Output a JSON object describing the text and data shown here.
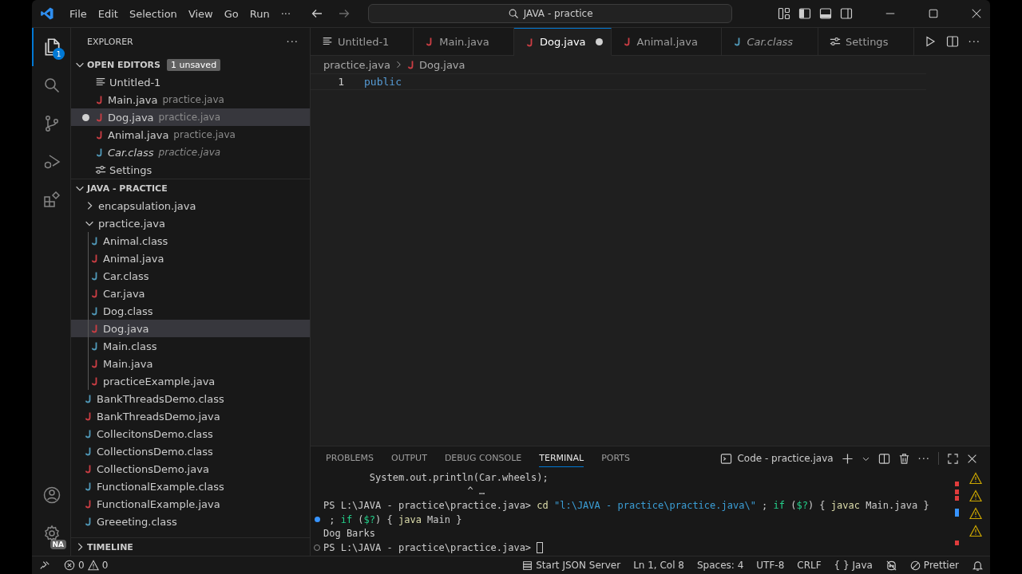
{
  "title_bar": {
    "menus": [
      "File",
      "Edit",
      "Selection",
      "View",
      "Go",
      "Run"
    ],
    "more": "···",
    "search": "JAVA - practice"
  },
  "activity_bar": {
    "items": [
      {
        "kind": "explorer",
        "selected": true,
        "badge": "1"
      },
      {
        "kind": "search",
        "selected": false
      },
      {
        "kind": "source-control",
        "selected": false
      },
      {
        "kind": "run-debug",
        "selected": false
      },
      {
        "kind": "extensions",
        "selected": false
      }
    ],
    "bottom": [
      {
        "kind": "account"
      },
      {
        "kind": "manage",
        "badge": "NA"
      }
    ]
  },
  "sidebar": {
    "title": "EXPLORER",
    "more": "···",
    "open_editors": {
      "title": "OPEN EDITORS",
      "expanded": true,
      "badge": "1 unsaved",
      "items": [
        {
          "label": "Untitled-1",
          "kind": "untitled",
          "dirty": false,
          "italic": false,
          "selected": false
        },
        {
          "label": "Main.java",
          "description": "practice.java",
          "kind": "java",
          "dirty": false,
          "italic": false,
          "selected": false
        },
        {
          "label": "Dog.java",
          "description": "practice.java",
          "kind": "java",
          "dirty": true,
          "italic": false,
          "selected": true
        },
        {
          "label": "Animal.java",
          "description": "practice.java",
          "kind": "java",
          "dirty": false,
          "italic": false,
          "selected": false
        },
        {
          "label": "Car.class",
          "description": "practice.java",
          "kind": "class",
          "dirty": false,
          "italic": true,
          "selected": false
        },
        {
          "label": "Settings",
          "kind": "settings",
          "dirty": false,
          "italic": false,
          "selected": false
        }
      ]
    },
    "workspace": {
      "title": "JAVA - PRACTICE",
      "expanded": true,
      "items": [
        {
          "label": "encapsulation.java",
          "kind": "folder",
          "expanded": false,
          "selected": false
        },
        {
          "label": "practice.java",
          "kind": "folder",
          "expanded": true,
          "selected": false,
          "children": [
            {
              "label": "Animal.class",
              "kind": "class",
              "selected": false
            },
            {
              "label": "Animal.java",
              "kind": "java",
              "selected": false
            },
            {
              "label": "Car.class",
              "kind": "class",
              "selected": false
            },
            {
              "label": "Car.java",
              "kind": "java",
              "selected": false
            },
            {
              "label": "Dog.class",
              "kind": "class",
              "selected": false
            },
            {
              "label": "Dog.java",
              "kind": "java",
              "selected": true
            },
            {
              "label": "Main.class",
              "kind": "class",
              "selected": false
            },
            {
              "label": "Main.java",
              "kind": "java",
              "selected": false
            },
            {
              "label": "practiceExample.java",
              "kind": "java",
              "selected": false
            }
          ]
        },
        {
          "label": "BankThreadsDemo.class",
          "kind": "class",
          "selected": false
        },
        {
          "label": "BankThreadsDemo.java",
          "kind": "java",
          "selected": false
        },
        {
          "label": "CollecitonsDemo.class",
          "kind": "class",
          "selected": false
        },
        {
          "label": "CollectionsDemo.class",
          "kind": "class",
          "selected": false
        },
        {
          "label": "CollectionsDemo.java",
          "kind": "java",
          "selected": false
        },
        {
          "label": "FunctionalExample.class",
          "kind": "class",
          "selected": false
        },
        {
          "label": "FunctionalExample.java",
          "kind": "java",
          "selected": false
        },
        {
          "label": "Greeeting.class",
          "kind": "class",
          "selected": false
        }
      ]
    },
    "timeline": {
      "title": "TIMELINE",
      "expanded": false
    }
  },
  "editor": {
    "tabs": [
      {
        "label": "Untitled-1",
        "kind": "untitled",
        "selected": false,
        "dirty": false,
        "italic": false
      },
      {
        "label": "Main.java",
        "kind": "java",
        "selected": false,
        "dirty": false,
        "italic": false
      },
      {
        "label": "Dog.java",
        "kind": "java",
        "selected": true,
        "dirty": true,
        "italic": false
      },
      {
        "label": "Animal.java",
        "kind": "java",
        "selected": false,
        "dirty": false,
        "italic": false
      },
      {
        "label": "Car.class",
        "kind": "class",
        "selected": false,
        "dirty": false,
        "italic": true
      },
      {
        "label": "Settings",
        "kind": "settings",
        "selected": false,
        "dirty": false,
        "italic": false
      }
    ],
    "more": "···",
    "breadcrumbs": [
      {
        "label": "practice.java",
        "kind": "folder"
      },
      {
        "label": "Dog.java",
        "kind": "java"
      }
    ],
    "lines": [
      {
        "number": "1",
        "tokens": [
          {
            "text": "public",
            "kind": "keyword"
          }
        ]
      }
    ]
  },
  "panel": {
    "tabs": [
      {
        "label": "PROBLEMS",
        "selected": false
      },
      {
        "label": "OUTPUT",
        "selected": false
      },
      {
        "label": "DEBUG CONSOLE",
        "selected": false
      },
      {
        "label": "TERMINAL",
        "selected": true
      },
      {
        "label": "PORTS",
        "selected": false
      }
    ],
    "terminal_name": "Code - practice.java",
    "more": "···",
    "lines": [
      {
        "kind": "output",
        "segments": [
          {
            "text": "        System.out.println(Car.wheels);",
            "kind": "plain"
          }
        ]
      },
      {
        "kind": "output",
        "segments": [
          {
            "text": "                         ^ …",
            "kind": "plain"
          }
        ]
      },
      {
        "kind": "output",
        "segments": [
          {
            "text": "PS L:\\JAVA - practice\\practice.java> ",
            "kind": "plain"
          },
          {
            "text": "cd",
            "kind": "command"
          },
          {
            "text": " \"l:\\JAVA - practice\\practice.java\\\"",
            "kind": "string"
          },
          {
            "text": " ; ",
            "kind": "plain"
          },
          {
            "text": "if",
            "kind": "keyword"
          },
          {
            "text": " (",
            "kind": "plain"
          },
          {
            "text": "$?",
            "kind": "keyword"
          },
          {
            "text": ") { ",
            "kind": "plain"
          },
          {
            "text": "javac",
            "kind": "command"
          },
          {
            "text": " Main.java }",
            "kind": "plain"
          }
        ]
      },
      {
        "kind": "succeeded-command",
        "segments": [
          {
            "text": " ; ",
            "kind": "plain"
          },
          {
            "text": "if",
            "kind": "keyword"
          },
          {
            "text": " (",
            "kind": "plain"
          },
          {
            "text": "$?",
            "kind": "keyword"
          },
          {
            "text": ") { ",
            "kind": "plain"
          },
          {
            "text": "java",
            "kind": "command"
          },
          {
            "text": " Main }",
            "kind": "plain"
          }
        ]
      },
      {
        "kind": "output",
        "segments": [
          {
            "text": "Dog Barks",
            "kind": "plain"
          }
        ]
      },
      {
        "kind": "pending-command",
        "cursor": true,
        "segments": [
          {
            "text": "PS L:\\JAVA - practice\\practice.java> ",
            "kind": "plain"
          }
        ]
      }
    ]
  },
  "status_bar": {
    "left": [
      {
        "kind": "remote"
      },
      {
        "kind": "problems",
        "errors": "0",
        "warnings": "0"
      }
    ],
    "right": [
      {
        "kind": "server",
        "text": "Start JSON Server"
      },
      {
        "kind": "plain",
        "text": "Ln 1, Col 8"
      },
      {
        "kind": "plain",
        "text": "Spaces: 4"
      },
      {
        "kind": "plain",
        "text": "UTF-8"
      },
      {
        "kind": "plain",
        "text": "CRLF"
      },
      {
        "kind": "plain",
        "text": "{ } Java"
      },
      {
        "kind": "copilot"
      },
      {
        "kind": "prettier",
        "text": "Prettier"
      },
      {
        "kind": "bell"
      }
    ]
  }
}
